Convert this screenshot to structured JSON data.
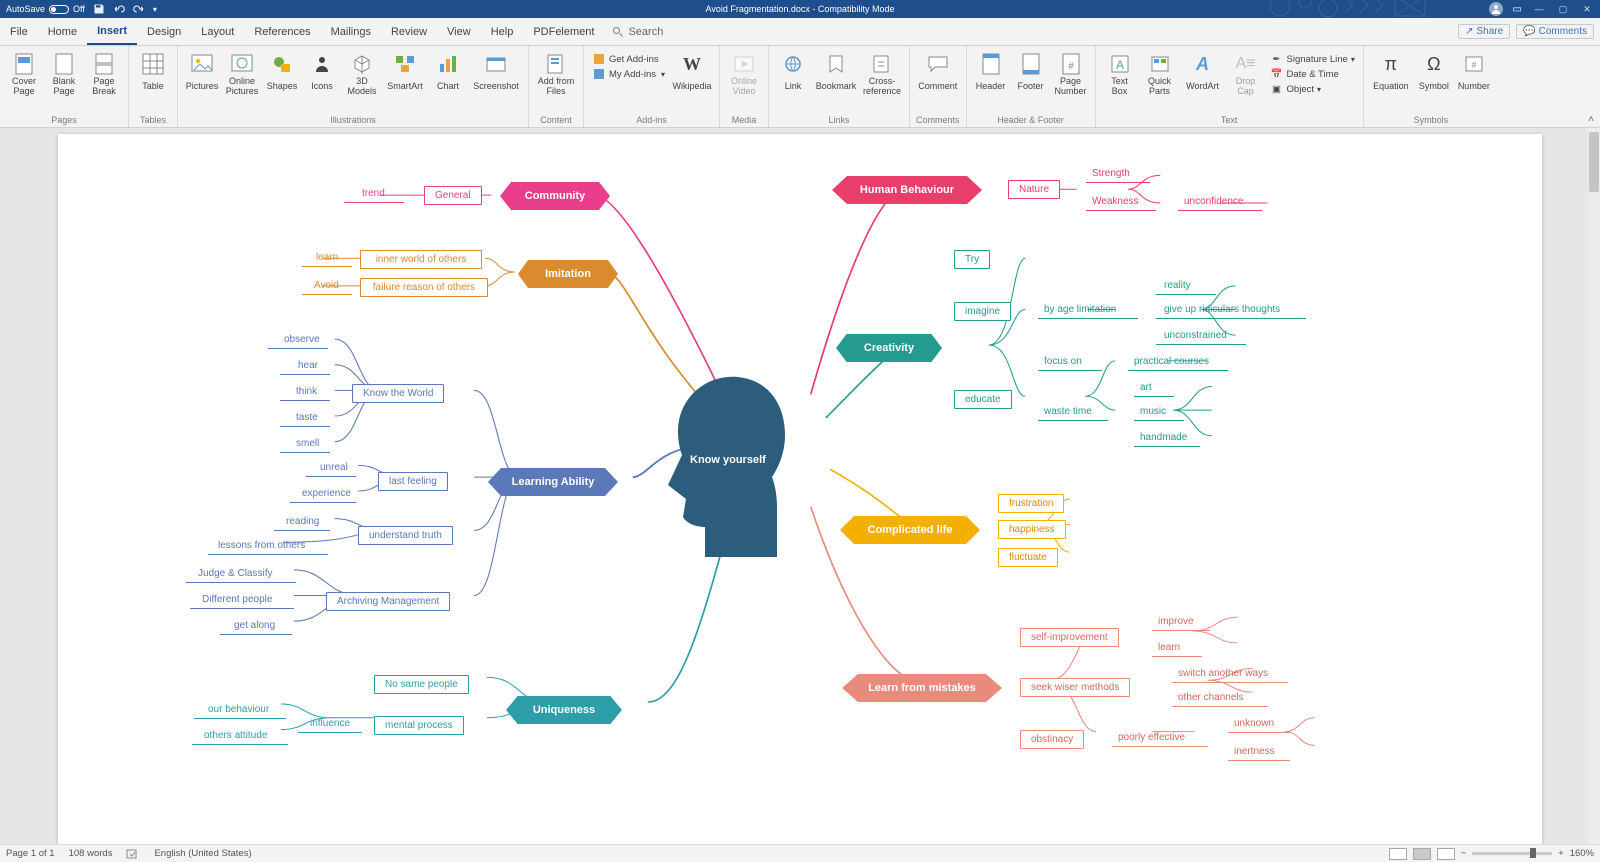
{
  "titlebar": {
    "autosave_label": "AutoSave",
    "autosave_state": "Off",
    "doc_title": "Avoid Fragmentation.docx  -  Compatibility Mode",
    "win_min": "—",
    "win_max": "▢",
    "win_close": "✕"
  },
  "tabs": {
    "items": [
      "File",
      "Home",
      "Insert",
      "Design",
      "Layout",
      "References",
      "Mailings",
      "Review",
      "View",
      "Help",
      "PDFelement"
    ],
    "active_index": 2,
    "search_placeholder": "Search",
    "share": "Share",
    "comments": "Comments"
  },
  "ribbon": {
    "groups": {
      "pages": {
        "label": "Pages",
        "cover": "Cover\nPage",
        "blank": "Blank\nPage",
        "break": "Page\nBreak"
      },
      "tables": {
        "label": "Tables",
        "table": "Table"
      },
      "illustrations": {
        "label": "Illustrations",
        "pictures": "Pictures",
        "online": "Online\nPictures",
        "shapes": "Shapes",
        "icons": "Icons",
        "models": "3D\nModels",
        "smartart": "SmartArt",
        "chart": "Chart",
        "screenshot": "Screenshot"
      },
      "content": {
        "label": "Content",
        "addfiles": "Add from\nFiles"
      },
      "addins": {
        "label": "Add-ins",
        "get": "Get Add-ins",
        "my": "My Add-ins",
        "wiki": "Wikipedia"
      },
      "media": {
        "label": "Media",
        "video": "Online\nVideo"
      },
      "links": {
        "label": "Links",
        "link": "Link",
        "bookmark": "Bookmark",
        "cross": "Cross-\nreference"
      },
      "comments": {
        "label": "Comments",
        "comment": "Comment"
      },
      "hf": {
        "label": "Header & Footer",
        "header": "Header",
        "footer": "Footer",
        "page": "Page\nNumber"
      },
      "text": {
        "label": "Text",
        "textbox": "Text\nBox",
        "quick": "Quick\nParts",
        "wordart": "WordArt",
        "drop": "Drop\nCap",
        "sig": "Signature Line",
        "date": "Date & Time",
        "obj": "Object"
      },
      "symbols": {
        "label": "Symbols",
        "eq": "Equation",
        "sym": "Symbol",
        "num": "Number"
      }
    }
  },
  "mindmap": {
    "center": "Know yourself",
    "branches": {
      "community": {
        "label": "Community",
        "color": "#e83e8c",
        "items": {
          "general": "General",
          "trend": "trend"
        }
      },
      "imitation": {
        "label": "Imitation",
        "color": "#d98b2e",
        "items": {
          "inner": "inner world of others",
          "failure": "failure reason of others",
          "learn": "learn",
          "avoid": "Avoid"
        }
      },
      "learning": {
        "label": "Learning Ability",
        "color": "#5b78b8",
        "items": {
          "knowworld": "Know the World",
          "observe": "observe",
          "hear": "hear",
          "think": "think",
          "taste": "taste",
          "smell": "smell",
          "lastfeeling": "last feeling",
          "unreal": "unreal",
          "experience": "experience",
          "understand": "understand truth",
          "reading": "reading",
          "lessons": "lessons from others",
          "archiving": "Archiving Management",
          "judge": "Judge & Classify",
          "diff": "Different people",
          "getalong": "get along"
        }
      },
      "uniqueness": {
        "label": "Uniqueness",
        "color": "#2d9ea8",
        "items": {
          "nosame": "No same people",
          "mental": "mental process",
          "influence": "influence",
          "our": "our behaviour",
          "others": "others attitude"
        }
      },
      "human": {
        "label": "Human Behaviour",
        "color": "#e83e6b",
        "items": {
          "nature": "Nature",
          "strength": "Strength",
          "weakness": "Weakness",
          "unconf": "unconfidence"
        }
      },
      "creativity": {
        "label": "Creativity",
        "color": "#259b90",
        "items": {
          "try": "Try",
          "imagine": "imagine",
          "byage": "by age limitation",
          "reality": "reality",
          "giveup": "give up ridiculars thoughts",
          "unconstrained": "unconstrained",
          "educate": "educate",
          "focuson": "focus on",
          "practical": "practical courses",
          "waste": "waste time",
          "art": "art",
          "music": "music",
          "handmade": "handmade"
        }
      },
      "complicated": {
        "label": "Complicated life",
        "color": "#f3b000",
        "items": {
          "frustration": "frustration",
          "happiness": "happiness",
          "fluctuate": "fluctuate"
        }
      },
      "mistakes": {
        "label": "Learn from mistakes",
        "color": "#e88b7d",
        "items": {
          "selfimp": "self-improvement",
          "improve": "improve",
          "learn": "learn",
          "seek": "seek wiser methods",
          "switch": "switch another ways",
          "channels": "other channels",
          "obstinacy": "obstinacy",
          "poorly": "poorly effective",
          "unknown": "unknown",
          "inertness": "inertness"
        }
      }
    }
  },
  "status": {
    "page": "Page 1 of 1",
    "words": "108 words",
    "lang": "English (United States)",
    "zoom": "160%"
  }
}
